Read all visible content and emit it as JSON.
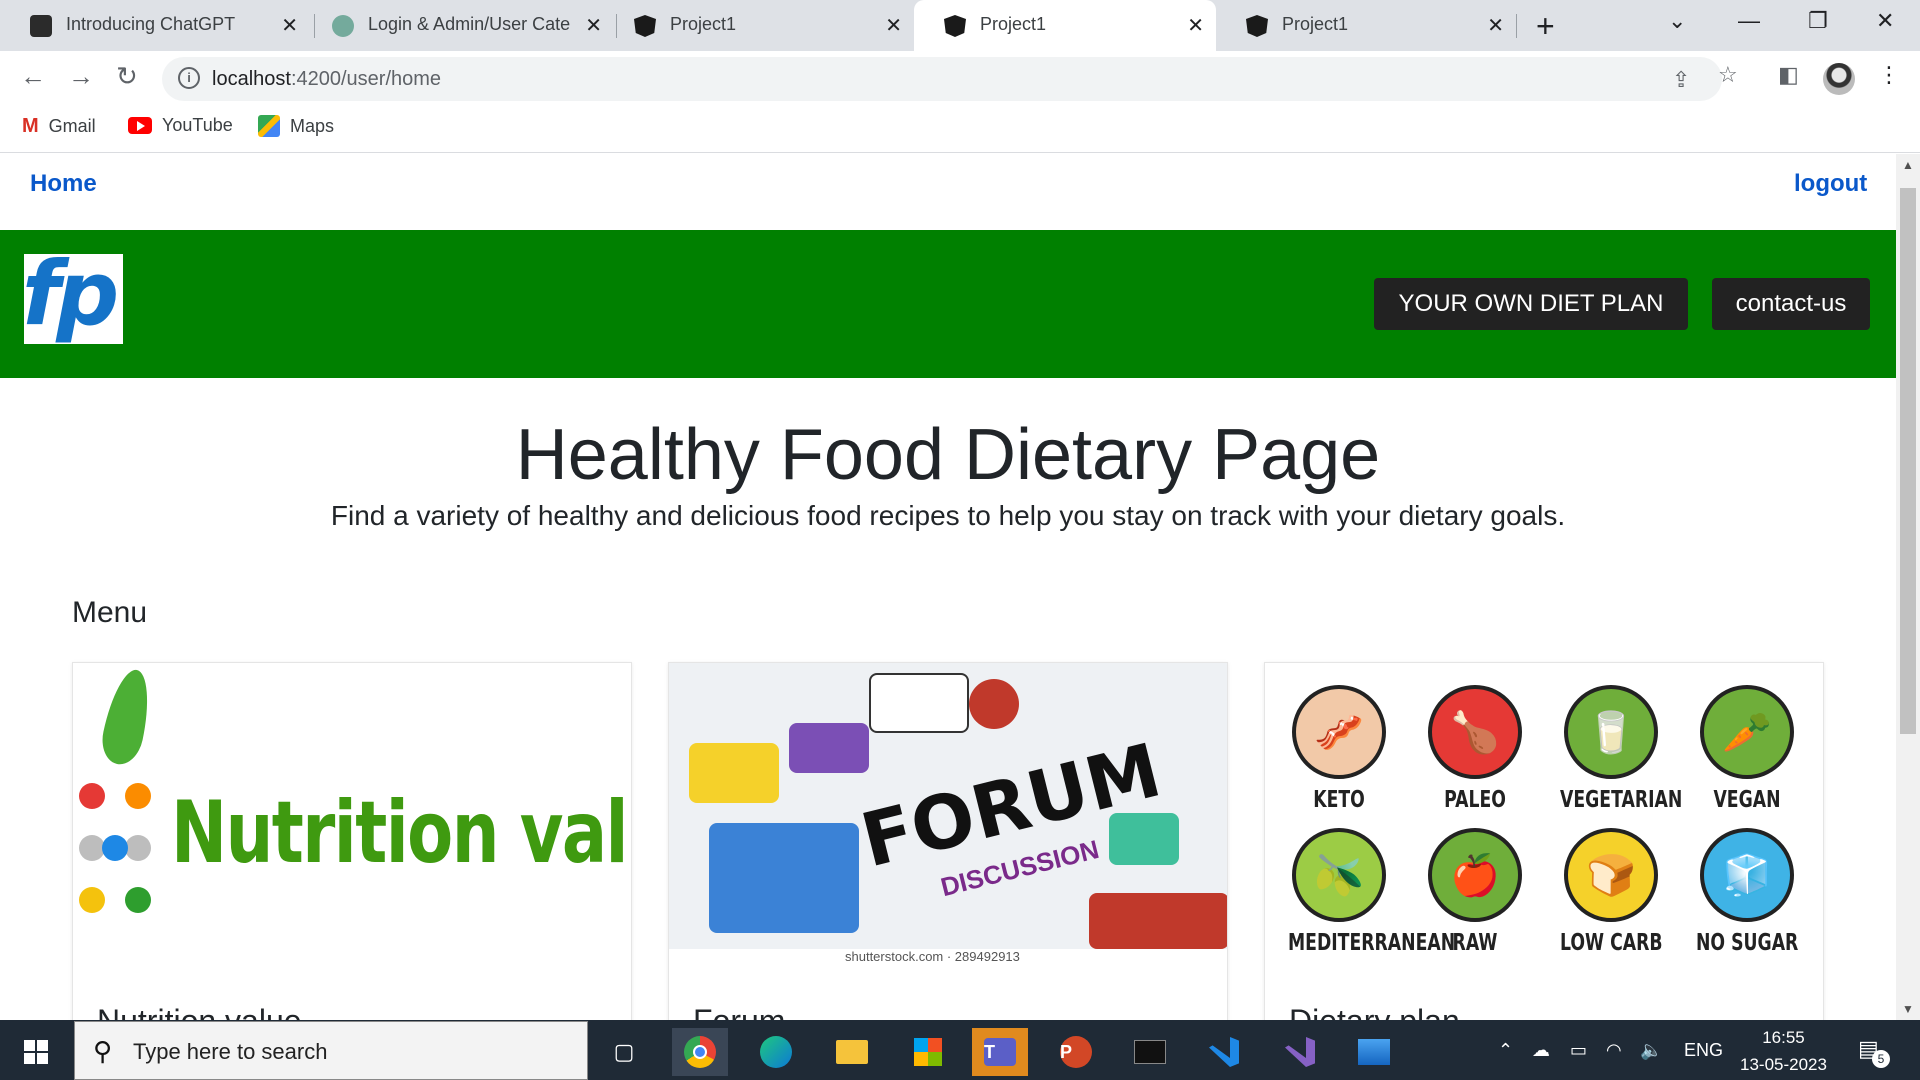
{
  "browser": {
    "tabs": [
      {
        "title": "Introducing ChatGPT",
        "active": false
      },
      {
        "title": "Login & Admin/User Cate",
        "active": false
      },
      {
        "title": "Project1",
        "active": false
      },
      {
        "title": "Project1",
        "active": true
      },
      {
        "title": "Project1",
        "active": false
      }
    ],
    "close_glyph": "✕",
    "new_tab_glyph": "+",
    "url_host": "localhost",
    "url_rest": ":4200/user/home",
    "bookmarks": [
      {
        "label": "Gmail",
        "icon": "gmail-icon"
      },
      {
        "label": "YouTube",
        "icon": "youtube-icon"
      },
      {
        "label": "Maps",
        "icon": "maps-icon"
      }
    ]
  },
  "page": {
    "nav": {
      "home": "Home",
      "logout": "logout"
    },
    "logo_text": "fp",
    "buttons": {
      "diet_plan": "YOUR OWN DIET PLAN",
      "contact": "contact-us"
    },
    "heading": "Healthy Food Dietary Page",
    "lead": "Find a variety of healthy and delicious food recipes to help you stay on track with your dietary goals.",
    "menu_heading": "Menu",
    "cards": [
      {
        "title": "Nutrition value",
        "image_text": "Nutrition value"
      },
      {
        "title": "Forum",
        "image_text": "FORUM",
        "image_sub": "DISCUSSION",
        "credit": "shutterstock.com · 289492913"
      },
      {
        "title": "Dietary plan"
      }
    ],
    "diets": [
      {
        "label": "KETO",
        "color": "#f2c9a8",
        "glyph": "🥓"
      },
      {
        "label": "PALEO",
        "color": "#e53935",
        "glyph": "🍗"
      },
      {
        "label": "VEGETARIAN",
        "color": "#6fae3a",
        "glyph": "🥕"
      },
      {
        "label": "VEGAN",
        "color": "#6fae3a",
        "glyph": "🥕"
      },
      {
        "label": "MEDITERRANEAN",
        "color": "#9ccc45",
        "glyph": "🫒"
      },
      {
        "label": "RAW",
        "color": "#6fae3a",
        "glyph": "🍎"
      },
      {
        "label": "LOW CARB",
        "color": "#f5d12a",
        "glyph": "🍞"
      },
      {
        "label": "NO SUGAR",
        "color": "#3fb3e6",
        "glyph": "🧊"
      }
    ]
  },
  "taskbar": {
    "search_placeholder": "Type here to search",
    "lang": "ENG",
    "time": "16:55",
    "date": "13-05-2023",
    "notification_count": "5"
  },
  "colors": {
    "brand_green": "#008000",
    "link_blue": "#0a58ca",
    "dark_button": "#222222"
  }
}
